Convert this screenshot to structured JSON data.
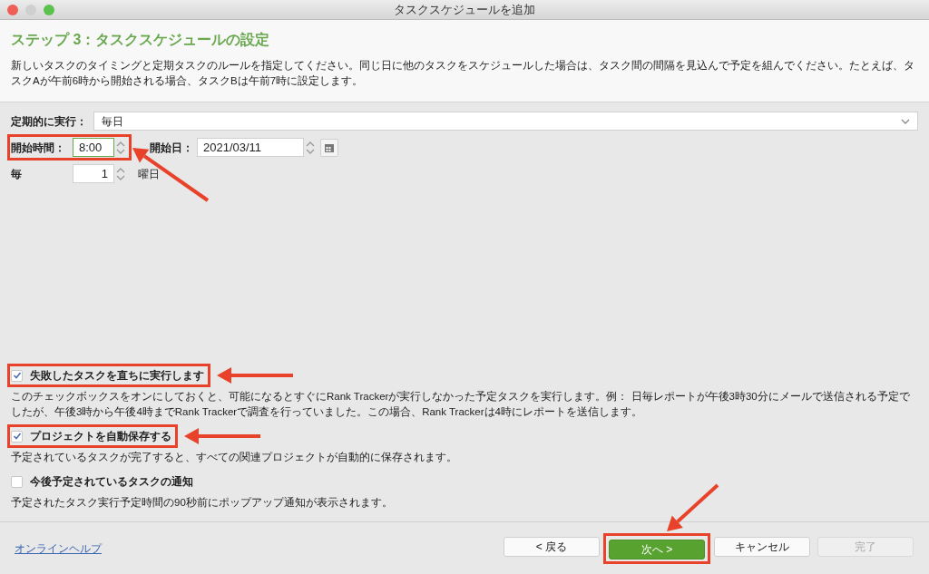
{
  "window": {
    "title": "タスクスケジュールを追加"
  },
  "header": {
    "title": "ステップ 3：タスクスケジュールの設定",
    "description": "新しいタスクのタイミングと定期タスクのルールを指定してください。同じ日に他のタスクをスケジュールした場合は、タスク間の間隔を見込んで予定を組んでください。たとえば、タスクAが午前6時から開始される場合、タスクBは午前7時に設定します。"
  },
  "recurrence": {
    "label": "定期的に実行：",
    "value": "毎日"
  },
  "start_time": {
    "label": "開始時間：",
    "value": "8:00",
    "focused": true
  },
  "start_date": {
    "label": "開始日：",
    "value": "2021/03/11"
  },
  "every": {
    "label": "毎",
    "value": "1",
    "unit": "曜日"
  },
  "options": [
    {
      "label": "失敗したタスクを直ちに実行します",
      "checked": true,
      "description": "このチェックボックスをオンにしておくと、可能になるとすぐにRank Trackerが実行しなかった予定タスクを実行します。例： 日毎レポートが午後3時30分にメールで送信される予定でしたが、午後3時から午後4時までRank Trackerで調査を行っていました。この場合、Rank Trackerは4時にレポートを送信します。"
    },
    {
      "label": "プロジェクトを自動保存する",
      "checked": true,
      "description": "予定されているタスクが完了すると、すべての関連プロジェクトが自動的に保存されます。"
    },
    {
      "label": "今後予定されているタスクの通知",
      "checked": false,
      "description": "予定されたタスク実行予定時間の90秒前にポップアップ通知が表示されます。"
    }
  ],
  "help_link": "オンラインヘルプ",
  "buttons": [
    {
      "label": "< 戻る",
      "kind": "normal",
      "disabled": false
    },
    {
      "label": "次へ >",
      "kind": "primary",
      "disabled": false
    },
    {
      "label": "キャンセル",
      "kind": "normal",
      "disabled": false
    },
    {
      "label": "完了",
      "kind": "normal",
      "disabled": true
    }
  ]
}
